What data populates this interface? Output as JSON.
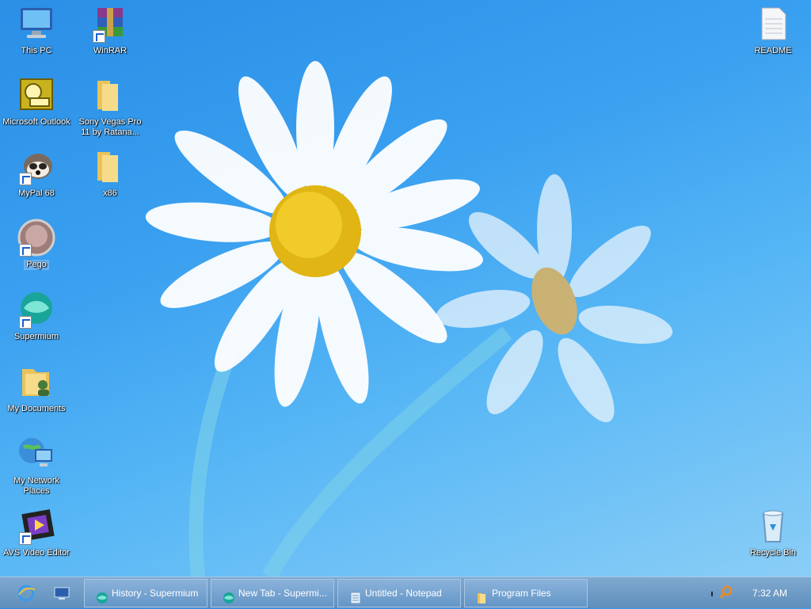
{
  "desktop": {
    "icons": [
      {
        "label": "This PC"
      },
      {
        "label": "WinRAR"
      },
      {
        "label": "Microsoft Outlook"
      },
      {
        "label": "Sony Vegas Pro 11 by Ratana..."
      },
      {
        "label": "MyPal 68"
      },
      {
        "label": "x86"
      },
      {
        "label": "Pego"
      },
      {
        "label": "Supermium"
      },
      {
        "label": "My Documents"
      },
      {
        "label": "My Network Places"
      },
      {
        "label": "AVS Video Editor"
      },
      {
        "label": "README"
      },
      {
        "label": "Recycle Bin"
      }
    ]
  },
  "taskbar": {
    "tasks": [
      {
        "label": "History - Supermium"
      },
      {
        "label": "New Tab - Supermi..."
      },
      {
        "label": "Untitled - Notepad"
      },
      {
        "label": "Program Files"
      }
    ],
    "clock": "7:32 AM"
  }
}
